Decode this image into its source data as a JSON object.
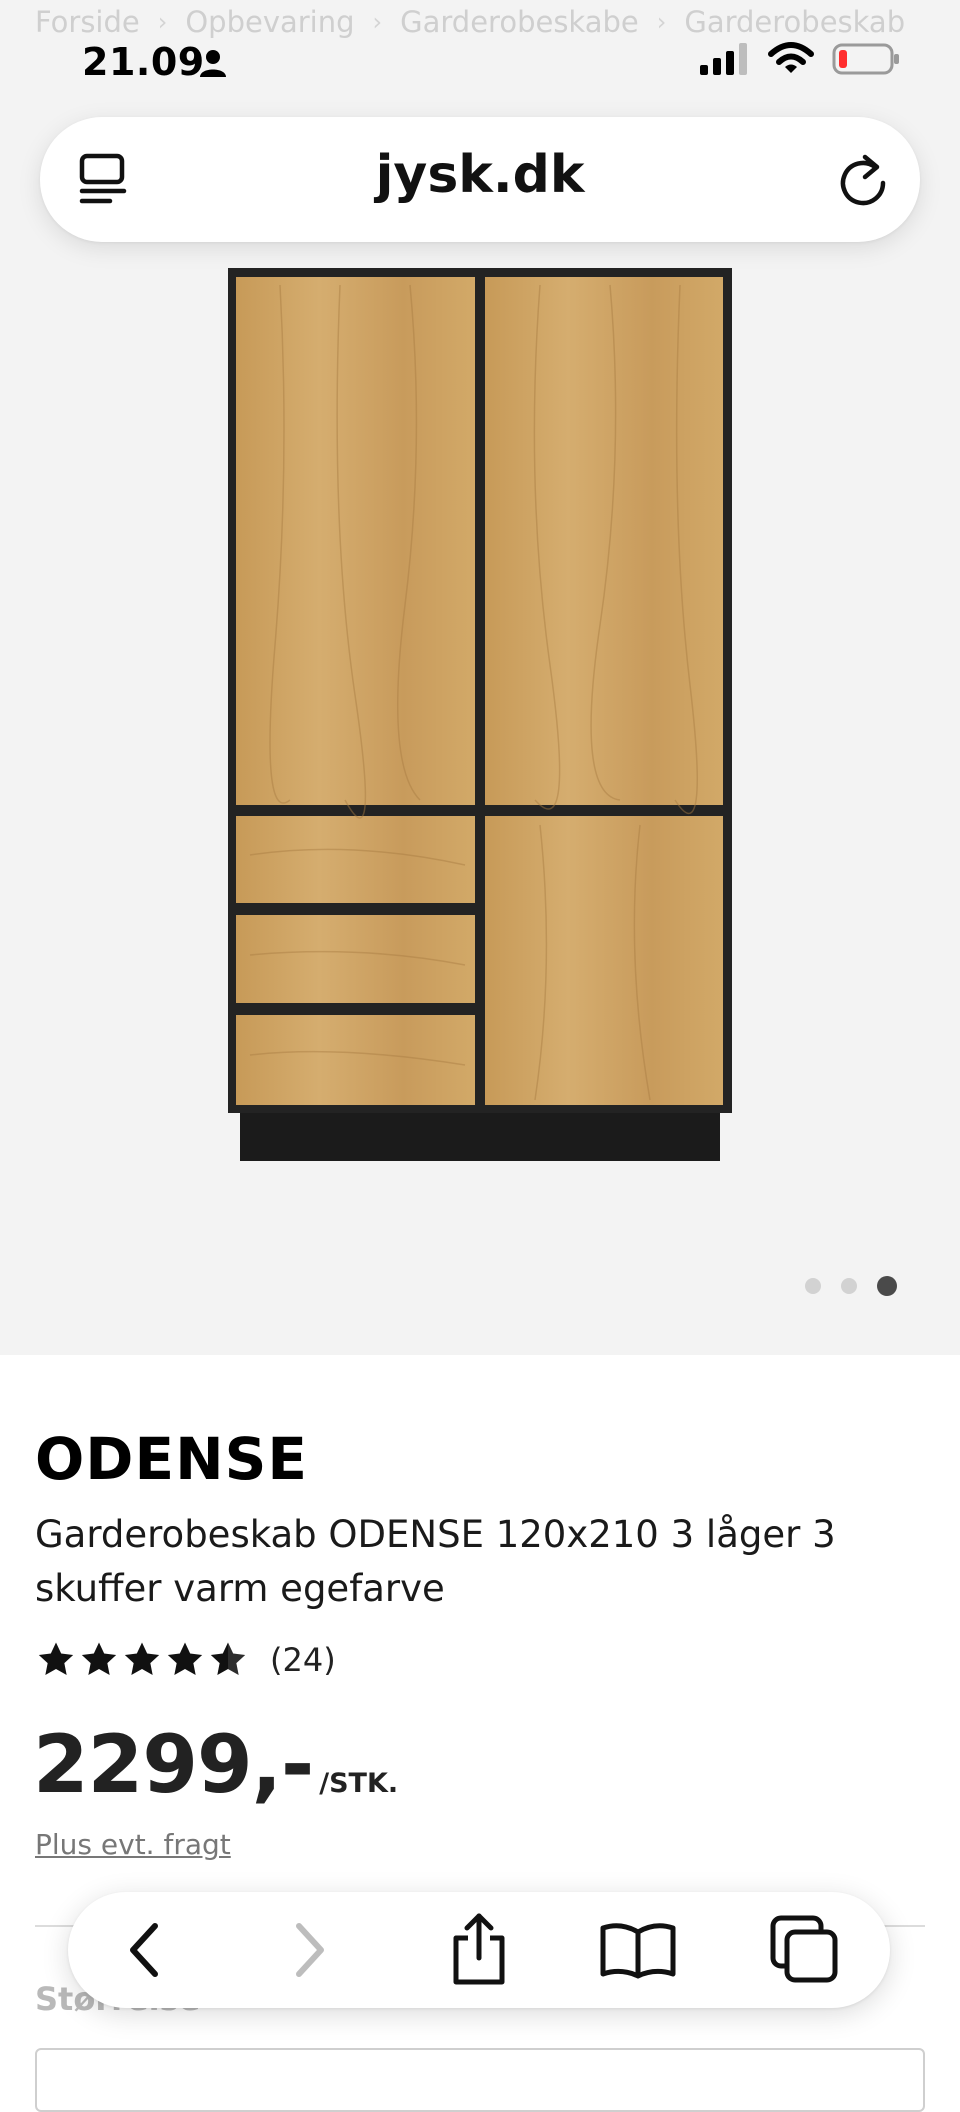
{
  "status_bar": {
    "time": "21.09",
    "icons": [
      "person-icon",
      "signal-icon",
      "wifi-icon",
      "battery-low-icon"
    ]
  },
  "breadcrumb": [
    "Forside",
    "Opbevaring",
    "Garderobeskabe",
    "Garderobeskab"
  ],
  "browser": {
    "address": "jysk.dk",
    "toolbar_icons": [
      "back-icon",
      "forward-icon",
      "share-icon",
      "bookmarks-icon",
      "tabs-icon"
    ]
  },
  "gallery": {
    "image_count": 3,
    "active_index": 2
  },
  "product": {
    "title": "ODENSE",
    "description": "Garderobeskab ODENSE 120x210 3 låger 3 skuffer varm egefarve",
    "rating": 4.5,
    "review_count": "(24)",
    "price": "2299,-",
    "price_unit": "/STK.",
    "shipping_link": "Plus evt. fragt",
    "size_label": "Størrelse"
  },
  "colors": {
    "wood": "#c8a062",
    "frame": "#222222",
    "background": "#f3f3f3"
  }
}
